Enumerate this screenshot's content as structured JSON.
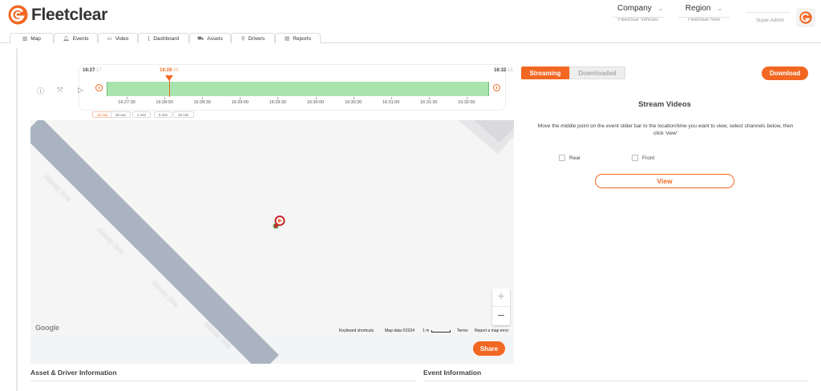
{
  "app": {
    "name": "Fleetclear",
    "brand_color": "#f26722"
  },
  "header": {
    "company": {
      "label": "Company",
      "value": "Fleetclear Vehicles"
    },
    "region": {
      "label": "Region",
      "value": "Fleetclear New"
    },
    "role": "Super-Admin"
  },
  "nav": {
    "tabs": [
      {
        "label": "Map",
        "icon": "map-icon"
      },
      {
        "label": "Events",
        "icon": "bell-icon"
      },
      {
        "label": "Video",
        "icon": "video-icon"
      },
      {
        "label": "Dashboard",
        "icon": "chart-icon"
      },
      {
        "label": "Assets",
        "icon": "truck-icon"
      },
      {
        "label": "Drivers",
        "icon": "person-icon"
      },
      {
        "label": "Reports",
        "icon": "document-icon"
      }
    ]
  },
  "timeline": {
    "start_time": "16:27",
    "start_time_faded": ":17",
    "current_time": "16:28",
    "current_time_faded": ":06",
    "end_time": "16:32",
    "end_time_faded": ":15",
    "ticks": [
      "16:27:30",
      "16:28:00",
      "16:28:30",
      "16:29:00",
      "16:29:30",
      "16:30:00",
      "16:30:30",
      "16:31:00",
      "16:31:30",
      "16:32:00"
    ],
    "zoom_options": [
      "12 min",
      "30 sec",
      "1 min",
      "5 min",
      "10 min"
    ],
    "active_zoom": "12 min"
  },
  "map": {
    "road_name": "Abney Ave",
    "google_label": "Google",
    "attribution": {
      "shortcuts": "Keyboard shortcuts",
      "map_data": "Map data ©2024",
      "scale": "1 m",
      "terms": "Terms",
      "report": "Report a map error"
    },
    "zoom_in": "+",
    "zoom_out": "−",
    "share_label": "Share"
  },
  "sections": {
    "asset_driver": "Asset & Driver Information",
    "event": "Event Information"
  },
  "stream_panel": {
    "tabs": [
      "Streaming",
      "Downloaded"
    ],
    "download_label": "Download",
    "title": "Stream Videos",
    "description": "Move the middle point on the event slider bar to the location/time you want to view, select channels below, then click 'view'",
    "channels": [
      "Rear",
      "Front"
    ],
    "view_label": "View"
  }
}
